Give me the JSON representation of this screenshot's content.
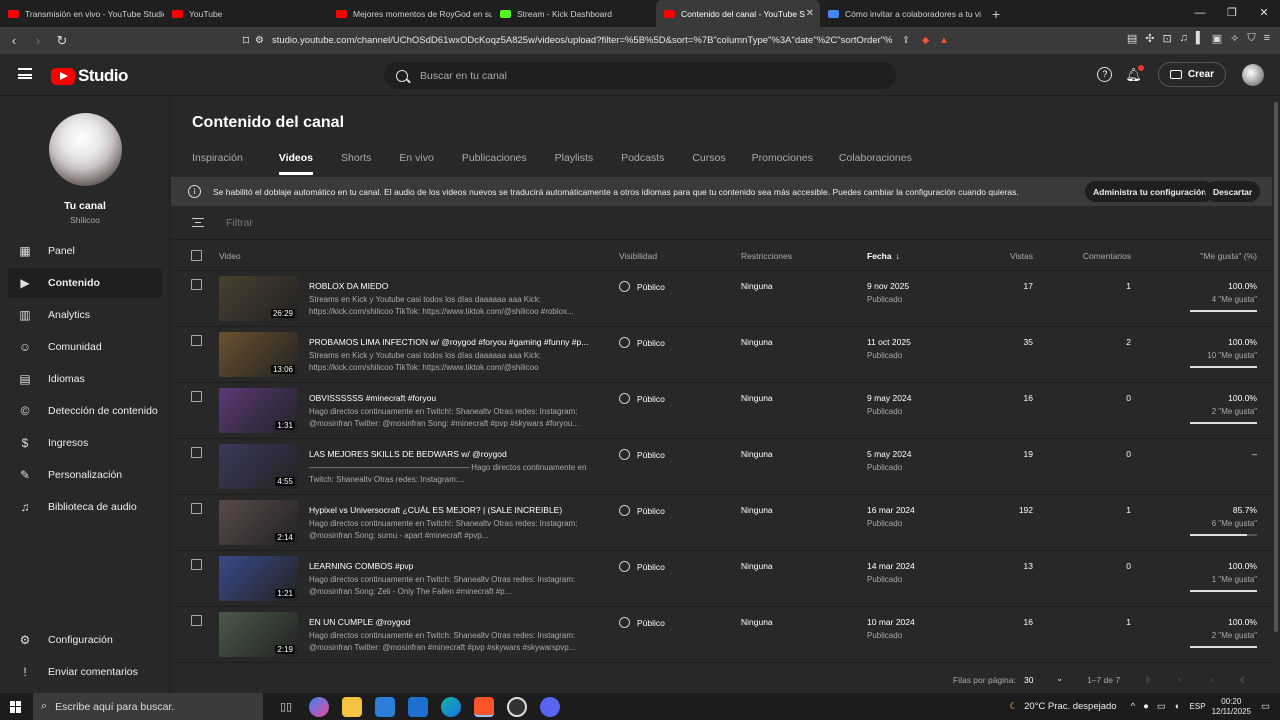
{
  "browser": {
    "tabs": [
      {
        "label": "Transmisión en vivo - YouTube Studio",
        "color": "#ff0000"
      },
      {
        "label": "YouTube",
        "color": "#ff0000"
      },
      {
        "label": "Mejores momentos de RoyGod en su",
        "color": "#ff0000"
      },
      {
        "label": "Stream - Kick Dashboard",
        "color": "#53fc18"
      },
      {
        "label": "Contenido del canal - YouTube S",
        "color": "#ff0000",
        "active": true
      },
      {
        "label": "Cómo invitar a colaboradores a tu vi",
        "color": "#4285f4"
      }
    ],
    "url": "studio.youtube.com/channel/UChOSdD61wxODcKoqz5A825w/videos/upload?filter=%5B%5D&sort=%7B\"columnType\"%3A\"date\"%2C\"sortOrder\"%3..."
  },
  "header": {
    "logo_text": "Studio",
    "search_placeholder": "Buscar en tu canal",
    "create_label": "Crear"
  },
  "sidebar": {
    "channel_title": "Tu canal",
    "channel_handle": "Shilicoo",
    "items": [
      {
        "label": "Panel",
        "icon": "dashboard-icon",
        "glyph": "▦"
      },
      {
        "label": "Contenido",
        "icon": "content-icon",
        "glyph": "▶",
        "active": true
      },
      {
        "label": "Analytics",
        "icon": "analytics-icon",
        "glyph": "▥"
      },
      {
        "label": "Comunidad",
        "icon": "community-icon",
        "glyph": "☺"
      },
      {
        "label": "Idiomas",
        "icon": "subtitles-icon",
        "glyph": "▤"
      },
      {
        "label": "Detección de contenido",
        "icon": "copyright-icon",
        "glyph": "©"
      },
      {
        "label": "Ingresos",
        "icon": "money-icon",
        "glyph": "$"
      },
      {
        "label": "Personalización",
        "icon": "customization-icon",
        "glyph": "✎"
      },
      {
        "label": "Biblioteca de audio",
        "icon": "audio-library-icon",
        "glyph": "♫"
      }
    ],
    "bottom": [
      {
        "label": "Configuración",
        "icon": "settings-icon",
        "glyph": "⚙"
      },
      {
        "label": "Enviar comentarios",
        "icon": "feedback-icon",
        "glyph": "!"
      }
    ]
  },
  "main": {
    "title": "Contenido del canal",
    "tabs": [
      "Inspiración",
      "Videos",
      "Shorts",
      "En vivo",
      "Publicaciones",
      "Playlists",
      "Podcasts",
      "Cursos",
      "Promociones",
      "Colaboraciones"
    ],
    "active_tab": "Videos",
    "banner": {
      "text": "Se habilitó el doblaje automático en tu canal. El audio de los videos nuevos se traducirá automáticamente a otros idiomas para que tu contenido sea más accesible. Puedes cambiar la configuración cuando quieras.",
      "manage_label": "Administra tu configuración",
      "dismiss_label": "Descartar"
    },
    "filter_placeholder": "Filtrar",
    "columns": {
      "video": "Video",
      "visibility": "Visibilidad",
      "restrictions": "Restricciones",
      "date": "Fecha",
      "views": "Vistas",
      "comments": "Comentarios",
      "likes": "\"Me gusta\" (%)"
    },
    "rows": [
      {
        "title": "ROBLOX DA MIEDO",
        "desc": "Streams en Kick y Youtube casi todos los días daaaaaa aaa Kick: https://kick.com/shilicoo TikTok: https://www.tiktok.com/@shilicoo #roblox...",
        "duration": "26:29",
        "visibility": "Público",
        "restrictions": "Ninguna",
        "date": "9 nov 2025",
        "status": "Publicado",
        "views": "17",
        "comments": "1",
        "likes_pct": "100.0%",
        "likes_count": "4 \"Me gusta\"",
        "ratio": 1.0,
        "thumb": "#4a4030"
      },
      {
        "title": "PROBAMOS LIMA INFECTION w/ @roygod #foryou #gaming #funny #p...",
        "desc": "Streams en Kick y Youtube casi todos los días daaaaaa aaa Kick: https://kick.com/shilicoo TikTok: https://www.tiktok.com/@shilicoo",
        "duration": "13:06",
        "visibility": "Público",
        "restrictions": "Ninguna",
        "date": "11 oct 2025",
        "status": "Publicado",
        "views": "35",
        "comments": "2",
        "likes_pct": "100.0%",
        "likes_count": "10 \"Me gusta\"",
        "ratio": 1.0,
        "thumb": "#6a5230"
      },
      {
        "title": "OBVISSSSSS #minecraft #foryou",
        "desc": "Hago directos continuamente en Twitch!: Shanealtv Otras redes: Instagram: @mosinfran Twitter: @mosinfran Song: #minecraft #pvp #skywars #foryou...",
        "duration": "1:31",
        "visibility": "Público",
        "restrictions": "Ninguna",
        "date": "9 may 2024",
        "status": "Publicado",
        "views": "16",
        "comments": "0",
        "likes_pct": "100.0%",
        "likes_count": "2 \"Me gusta\"",
        "ratio": 1.0,
        "thumb": "#5a3a78"
      },
      {
        "title": "LAS MEJORES SKILLS DE BEDWARS w/ @roygod",
        "desc": "———————————————————— Hago directos continuamente en Twitch: Shanealtv Otras redes: Instagram:...",
        "duration": "4:55",
        "visibility": "Público",
        "restrictions": "Ninguna",
        "date": "5 may 2024",
        "status": "Publicado",
        "views": "19",
        "comments": "0",
        "likes_pct": "–",
        "likes_count": "",
        "ratio": null,
        "thumb": "#3a3a5a"
      },
      {
        "title": "Hypixel vs Universocraft ¿CUÁL ES MEJOR? | (SALE INCREIBLE)",
        "desc": "Hago directos continuamente en Twitch!: Shanealtv Otras redes: Instagram: @mosinfran Song: sumu - apart #minecraft #pvp...",
        "duration": "2:14",
        "visibility": "Público",
        "restrictions": "Ninguna",
        "date": "16 mar 2024",
        "status": "Publicado",
        "views": "192",
        "comments": "1",
        "likes_pct": "85.7%",
        "likes_count": "6 \"Me gusta\"",
        "ratio": 0.857,
        "thumb": "#5a4a4a"
      },
      {
        "title": "LEARNING COMBOS #pvp",
        "desc": "Hago directos continuamente en Twitch: Shanealtv Otras redes: Instagram: @mosinfran Song: Zeli - Only The Fallen #minecraft #p...",
        "duration": "1:21",
        "visibility": "Público",
        "restrictions": "Ninguna",
        "date": "14 mar 2024",
        "status": "Publicado",
        "views": "13",
        "comments": "0",
        "likes_pct": "100.0%",
        "likes_count": "1 \"Me gusta\"",
        "ratio": 1.0,
        "thumb": "#3a4a8a"
      },
      {
        "title": "EN UN CUMPLE @roygod",
        "desc": "Hago directos continuamente en Twitch: Shanealtv Otras redes: Instagram: @mosinfran Twitter: @mosinfran #minecraft #pvp #skywars #skywarspvp...",
        "duration": "2:19",
        "visibility": "Público",
        "restrictions": "Ninguna",
        "date": "10 mar 2024",
        "status": "Publicado",
        "views": "16",
        "comments": "1",
        "likes_pct": "100.0%",
        "likes_count": "2 \"Me gusta\"",
        "ratio": 1.0,
        "thumb": "#4a5a4a"
      }
    ],
    "footer": {
      "rows_per_page_label": "Filas por página:",
      "rows_per_page": "30",
      "range": "1–7 de 7"
    }
  },
  "taskbar": {
    "search_placeholder": "Escribe aquí para buscar.",
    "weather": "20°C  Prac. despejado",
    "lang": "ESP",
    "time": "00:20",
    "date": "12/11/2025"
  }
}
